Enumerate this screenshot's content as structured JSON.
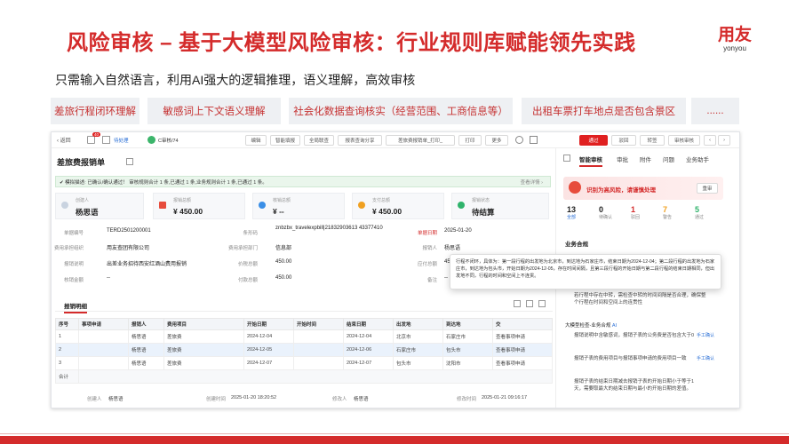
{
  "slide": {
    "title": "风险审核 – 基于大模型风险审核：行业规则库赋能领先实践",
    "logo_cn": "用友",
    "logo_en": "yonyou",
    "subtitle": "只需输入自然语言，利用AI强大的逻辑推理，语义理解，高效审核",
    "tags": [
      "差旅行程闭环理解",
      "敏感词上下文语义理解",
      "社会化数据查询核实（经营范围、工商信息等）",
      "出租车票打车地点是否包含景区",
      "......"
    ]
  },
  "app": {
    "toolbar": {
      "back": "返回",
      "left_badge": "40",
      "pending": "待处理",
      "status_tag": "C审核/74",
      "buttons": [
        "编辑",
        "智能填报",
        "全局联查",
        "报表查询分享",
        "差旅费报销单_打印_",
        "打印",
        "更多"
      ],
      "pass": "通过",
      "reject": "驳回",
      "forward": "转签",
      "sign": "审核审核"
    },
    "doc_title": "差旅费报销单",
    "pass_bar": "✔ 模拟描述: 已确认/确认通过！ 审核规则合计 1 条,已通过 1 条,业务规则合计 1 条,已通过 1 条。",
    "pass_bar_right": "查看详情 ›",
    "cards": [
      {
        "label": "创建人",
        "value": "杨思语"
      },
      {
        "label": "报销总额",
        "value": "¥ 450.00"
      },
      {
        "label": "核销总额",
        "value": "¥ --"
      },
      {
        "label": "支付总额",
        "value": "¥ 450.00"
      },
      {
        "label": "报销状态",
        "value": "待结算"
      }
    ],
    "fields": {
      "bill_no_label": "单据编号",
      "bill_no": "TERD2501200001",
      "barcode_label": "条形码",
      "barcode": "znbzbx_travelexpbill|21832903613 43377410",
      "bill_date_label": "单据日期",
      "bill_date": "2025-01-20",
      "org_label": "费用承担组织",
      "org": "用友查团有限公司",
      "dept_label": "费用承担部门",
      "dept": "信息部",
      "reporter_label": "报销人",
      "reporter": "杨思语",
      "reason_label": "报销说明",
      "reason": "出差业务招待西安红酒山费用报销",
      "price_label": "价税总额",
      "price": "450.00",
      "pay_label": "应付总额",
      "pay": "450.00",
      "verify_label": "核销金额",
      "verify": "--",
      "amount_label": "付款总额",
      "amount": "450.00",
      "remark_label": "备注",
      "remark": "--"
    },
    "tab_label": "报销明细",
    "table": {
      "headers": [
        "序号",
        "事项申请",
        "报销人",
        "费用项目",
        "开始日期",
        "开始时间",
        "结束日期",
        "出发地",
        "到达地",
        "交"
      ],
      "rows": [
        [
          "1",
          "",
          "杨思语",
          "差旅费",
          "2024-12-04",
          "",
          "2024-12-04",
          "北京市",
          "石家庄市",
          "查看事项申请"
        ],
        [
          "2",
          "",
          "杨思语",
          "差旅费",
          "2024-12-05",
          "",
          "2024-12-06",
          "石家庄市",
          "包头市",
          "查看事项申请"
        ],
        [
          "3",
          "",
          "杨思语",
          "差旅费",
          "2024-12-07",
          "",
          "2024-12-07",
          "包头市",
          "沈阳市",
          "查看事项申请"
        ]
      ],
      "total_label": "合计"
    },
    "footer": {
      "creator_label": "创建人",
      "creator": "杨思语",
      "create_time_label": "创建时间",
      "create_time": "2025-01-20 18:20:52",
      "modifier_label": "修改人",
      "modifier": "杨思语",
      "modify_time_label": "修改时间",
      "modify_time": "2025-01-21 09:16:17"
    },
    "right_panel": {
      "tabs": [
        "智能审核",
        "审批",
        "附件",
        "问题",
        "业务助手"
      ],
      "alert": "识别为高风险，请谨慎处理",
      "alert_btn": "重审",
      "stats": [
        {
          "n": "13",
          "t": "全部"
        },
        {
          "n": "0",
          "t": "待确认"
        },
        {
          "n": "1",
          "t": "驳回"
        },
        {
          "n": "7",
          "t": "警告"
        },
        {
          "n": "5",
          "t": "通过"
        }
      ],
      "section": "业务合规",
      "item_a": "若行程中存在中转，需检查中转的时间间隔是否合理，确保整个行程在时间和空间上的连贯性",
      "model_label": "大模型检查-业务合规",
      "item1": "报销说明中含敏感词，报销子表的公务费是否包含大于0",
      "item2": "报销子表的费用项目与报销事项申请的费用项目一致",
      "item3": "报销子表的结束日期减去报销子表的开始日期小于等于1天，需要取最大的结束日期与最小的开始日期的差值。",
      "manual": "手工确认"
    },
    "popup": "行程不闭环，具体为：第一段行程的出发地为北京市，到达地为石家庄市，结束日期为2024-12-04；第二段行程的出发地为石家庄市，到达地为包头市，开始日期为2024-12-05，存在时间间隔，且第三段行程的开始日期与第二段行程的结束日期相同，但出发地不同，行程的时间和空间上不连贯。"
  },
  "colors": {
    "accent": "#d42b2b",
    "link": "#2a6fd6"
  }
}
